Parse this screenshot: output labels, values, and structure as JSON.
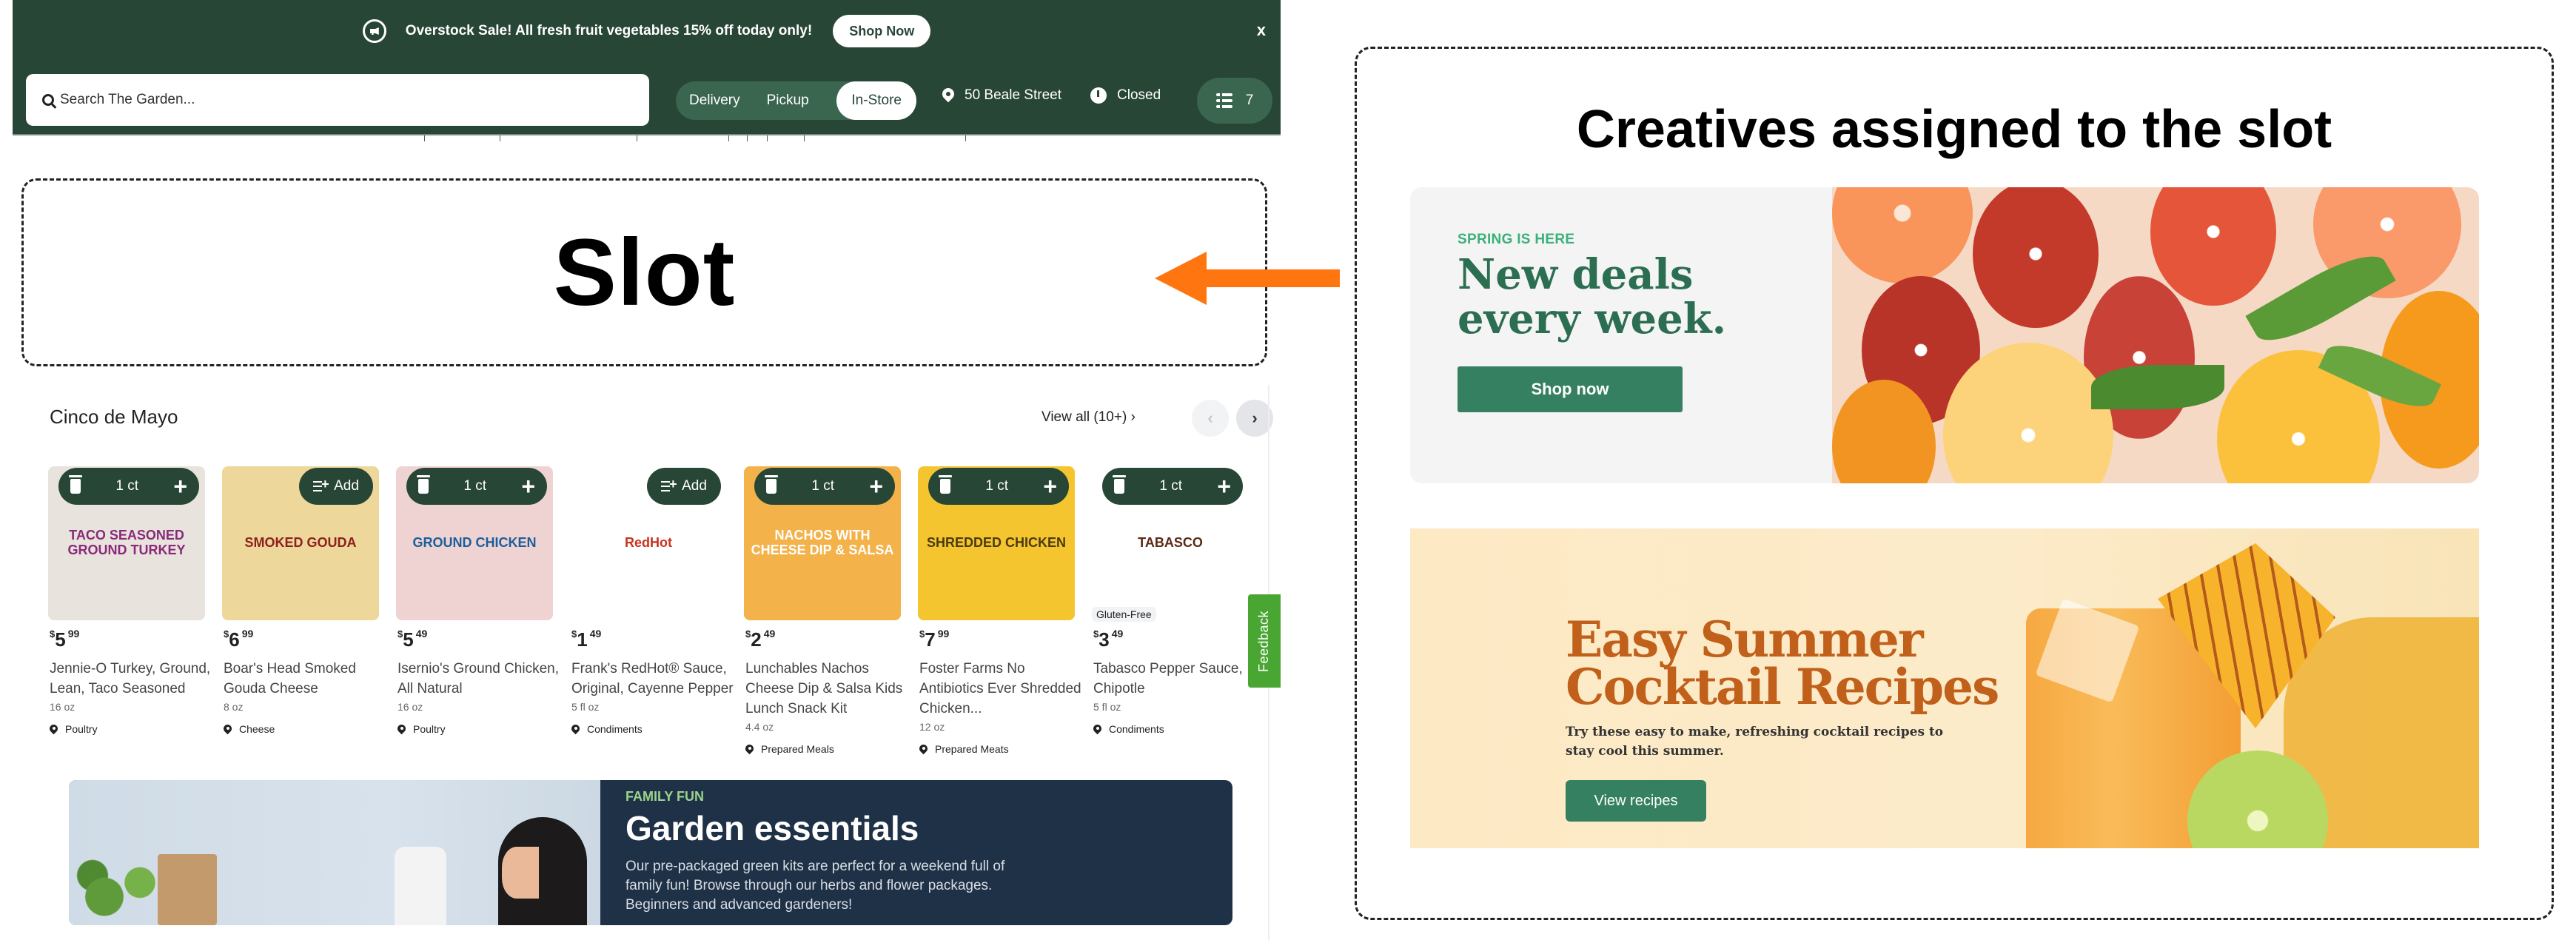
{
  "announcement": {
    "icon": "megaphone-icon",
    "text": "Overstock Sale! All fresh fruit vegetables 15% off today only!",
    "cta": "Shop Now",
    "close": "x"
  },
  "header": {
    "search_placeholder": "Search The Garden...",
    "modes": [
      "Delivery",
      "Pickup",
      "In-Store"
    ],
    "active_mode": "In-Store",
    "store_address": "50 Beale Street",
    "store_status": "Closed",
    "cart_count": "7"
  },
  "slot": {
    "label": "Slot"
  },
  "section": {
    "title": "Cinco de Mayo",
    "view_all": "View all (10+)",
    "view_all_chevron": "›",
    "prev": "‹",
    "next": "›"
  },
  "products": [
    {
      "name": "Jennie-O Turkey, Ground, Lean, Taco Seasoned",
      "dollars": "5",
      "cents": "99",
      "size": "16 oz",
      "aisle": "Poultry",
      "control": "stepper",
      "qty": "1 ct",
      "image_label": "TACO SEASONED GROUND TURKEY",
      "img_bg": "#e9e3dd",
      "img_fg": "#8a2a7a"
    },
    {
      "name": "Boar's Head Smoked Gouda Cheese",
      "dollars": "6",
      "cents": "99",
      "size": "8 oz",
      "aisle": "Cheese",
      "control": "add",
      "add_label": "Add",
      "image_label": "SMOKED GOUDA",
      "img_bg": "#eed79a",
      "img_fg": "#8c1f1f"
    },
    {
      "name": "Isernio's Ground Chicken, All Natural",
      "dollars": "5",
      "cents": "49",
      "size": "16 oz",
      "aisle": "Poultry",
      "control": "stepper",
      "qty": "1 ct",
      "image_label": "GROUND CHICKEN",
      "img_bg": "#efd3d3",
      "img_fg": "#1b5e9a"
    },
    {
      "name": "Frank's RedHot® Sauce, Original, Cayenne Pepper",
      "dollars": "1",
      "cents": "49",
      "size": "5 fl oz",
      "aisle": "Condiments",
      "control": "add",
      "add_label": "Add",
      "image_label": "RedHot",
      "img_bg": "#ffffff",
      "img_fg": "#c8321f"
    },
    {
      "name": "Lunchables Nachos Cheese Dip & Salsa Kids Lunch Snack Kit",
      "dollars": "2",
      "cents": "49",
      "size": "4.4 oz",
      "aisle": "Prepared Meals",
      "control": "stepper",
      "qty": "1 ct",
      "image_label": "NACHOS WITH CHEESE DIP & SALSA",
      "img_bg": "#f4b24a",
      "img_fg": "#ffffff"
    },
    {
      "name": "Foster Farms No Antibiotics Ever Shredded Chicken...",
      "dollars": "7",
      "cents": "99",
      "size": "12 oz",
      "aisle": "Prepared Meats",
      "control": "stepper",
      "qty": "1 ct",
      "image_label": "SHREDDED CHICKEN",
      "img_bg": "#f5c530",
      "img_fg": "#4a3a10"
    },
    {
      "name": "Tabasco Pepper Sauce, Chipotle",
      "dollars": "3",
      "cents": "49",
      "size": "5 fl oz",
      "aisle": "Condiments",
      "control": "stepper",
      "qty": "1 ct",
      "badge": "Gluten-Free",
      "image_label": "TABASCO",
      "img_bg": "#ffffff",
      "img_fg": "#5a2a14"
    }
  ],
  "feedback": "Feedback",
  "promo_banner": {
    "kicker": "FAMILY FUN",
    "title": "Garden essentials",
    "description": "Our pre-packaged green kits are perfect for a weekend full of family fun! Browse through our herbs and flower packages. Beginners and advanced gardeners!"
  },
  "creatives_panel": {
    "title": "Creatives assigned to the slot",
    "creatives": [
      {
        "kicker": "SPRING IS HERE",
        "headline": "New deals every week.",
        "cta": "Shop now"
      },
      {
        "headline": "Easy Summer Cocktail Recipes",
        "description": "Try these easy to make, refreshing cocktail recipes to stay cool this summer.",
        "cta": "View recipes"
      }
    ]
  },
  "colors": {
    "brand_dark_green": "#284636",
    "toggle_green": "#3a6650",
    "cta_green": "#368062",
    "arrow_orange": "#ff7510",
    "feedback_green": "#4aa632",
    "promo_navy": "#1f3147",
    "cocktail_orange": "#c0601a"
  }
}
